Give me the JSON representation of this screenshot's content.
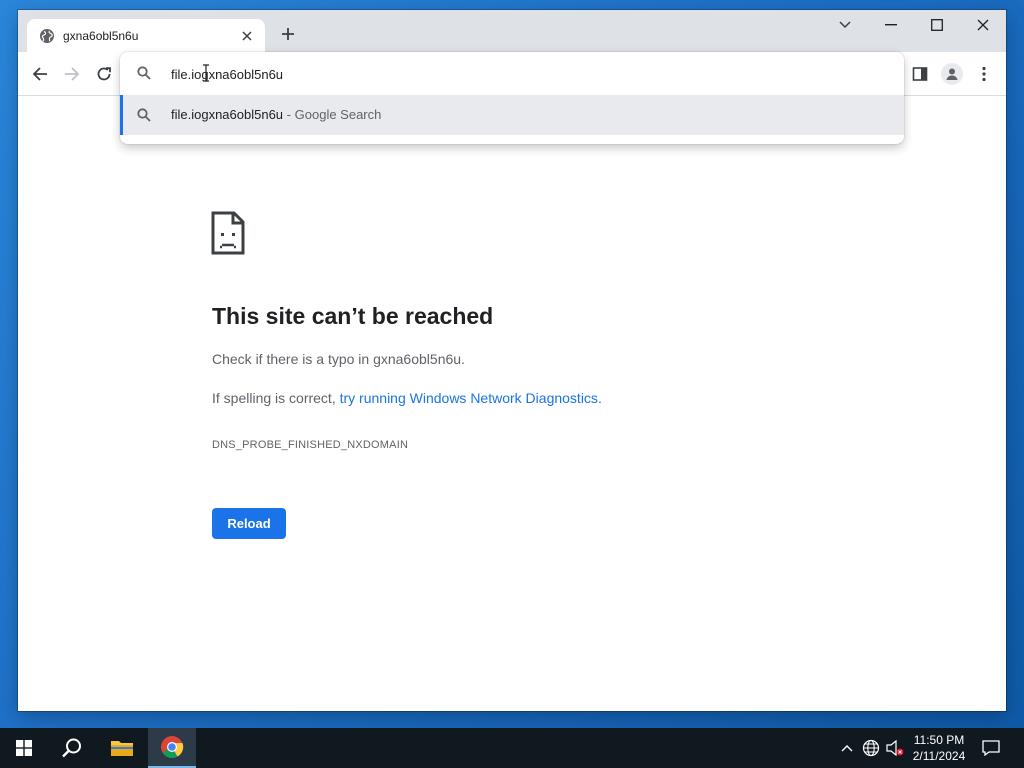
{
  "browser": {
    "tab": {
      "title": "gxna6obl5n6u",
      "icon": "globe-icon"
    },
    "omnibox": {
      "value": "file.iogxna6obl5n6u",
      "suggestion": {
        "text": "file.iogxna6obl5n6u",
        "separator": "-",
        "source": "Google Search"
      }
    }
  },
  "error_page": {
    "title": "This site can’t be reached",
    "line1": "Check if there is a typo in gxna6obl5n6u.",
    "line2_prefix": "If spelling is correct, ",
    "line2_link": "try running Windows Network Diagnostics",
    "line2_suffix": ".",
    "error_code": "DNS_PROBE_FINISHED_NXDOMAIN",
    "reload_label": "Reload"
  },
  "taskbar": {
    "time": "11:50 PM",
    "date": "2/11/2024"
  },
  "colors": {
    "accent": "#1a73e8",
    "taskbar": "#101820",
    "desktop": "#1d6fc6"
  }
}
